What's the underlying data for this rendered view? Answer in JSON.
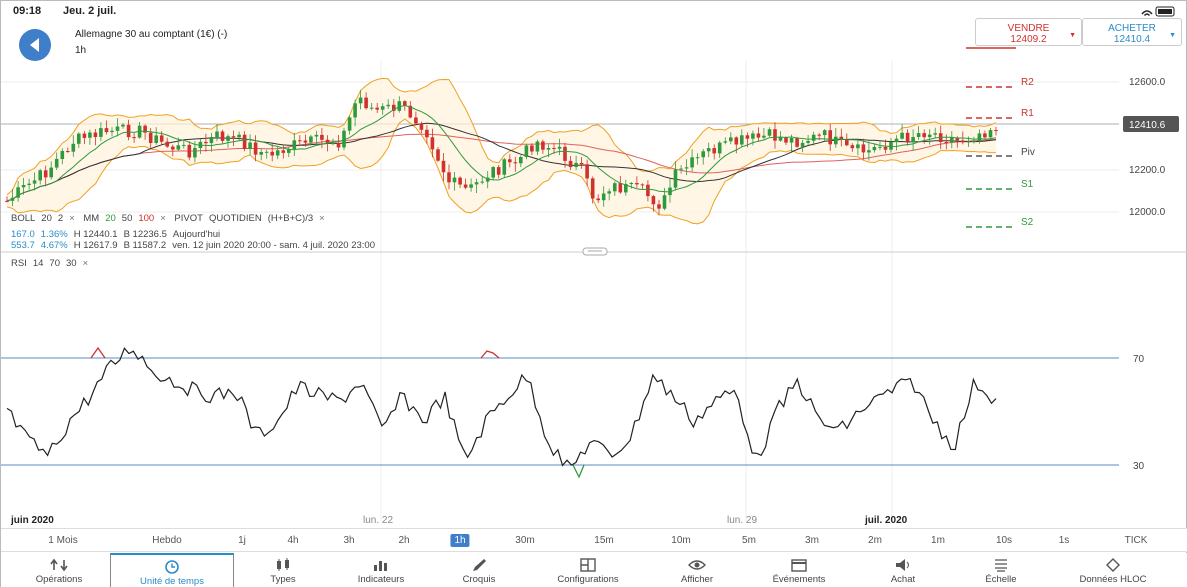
{
  "status": {
    "time": "09:18",
    "date": "Jeu. 2 juil."
  },
  "instrument": {
    "title": "Allemagne 30 au comptant (1€) (-)",
    "timeframe": "1h"
  },
  "trade": {
    "sell": {
      "label": "VENDRE",
      "price": "12409.2"
    },
    "buy": {
      "label": "ACHETER",
      "price": "12410.4"
    }
  },
  "price_axis": {
    "ticks": [
      "12600.0",
      "12200.0",
      "12000.0"
    ],
    "current": "12410.6"
  },
  "pivot_levels": [
    "R2",
    "R1",
    "Piv",
    "S1",
    "S2"
  ],
  "indicators": {
    "boll": {
      "name": "BOLL",
      "p1": "20",
      "p2": "2"
    },
    "mm": {
      "name": "MM",
      "p1": "20",
      "p2": "50",
      "p3": "100"
    },
    "pivot": {
      "name": "PIVOT",
      "mode": "QUOTIDIEN",
      "formula": "(H+B+C)/3"
    },
    "stats": {
      "r1_a": "167.0",
      "r1_b": "1.36%",
      "r1_h": "H 12440.1",
      "r1_l": "B 12236.5",
      "r1_label": "Aujourd'hui",
      "r2_a": "553.7",
      "r2_b": "4.67%",
      "r2_h": "H 12617.9",
      "r2_l": "B 11587.2",
      "r2_label": "ven. 12 juin 2020 20:00 - sam. 4 juil. 2020 23:00"
    },
    "rsi": {
      "name": "RSI",
      "p1": "14",
      "p2": "70",
      "p3": "30",
      "upper": "70",
      "lower": "30"
    }
  },
  "close_glyph": "×",
  "date_axis": [
    "juin 2020",
    "lun. 22",
    "lun. 29",
    "juil. 2020"
  ],
  "timeframes": [
    "1 Mois",
    "Hebdo",
    "1j",
    "4h",
    "3h",
    "2h",
    "1h",
    "30m",
    "15m",
    "10m",
    "5m",
    "3m",
    "2m",
    "1m",
    "10s",
    "1s",
    "TICK"
  ],
  "active_timeframe": "1h",
  "tabs": [
    {
      "label": "Opérations",
      "icon": "arrows-icon"
    },
    {
      "label": "Unité de temps",
      "icon": "clock-icon"
    },
    {
      "label": "Types",
      "icon": "candles-icon"
    },
    {
      "label": "Indicateurs",
      "icon": "bars-icon"
    },
    {
      "label": "Croquis",
      "icon": "pencil-icon"
    },
    {
      "label": "Configurations",
      "icon": "layout-icon"
    },
    {
      "label": "Afficher",
      "icon": "eye-icon"
    },
    {
      "label": "Événements",
      "icon": "calendar-icon"
    },
    {
      "label": "Achat",
      "icon": "speaker-icon"
    },
    {
      "label": "Échelle",
      "icon": "scale-icon"
    },
    {
      "label": "Données HLOC",
      "icon": "diamond-icon"
    }
  ],
  "active_tab": "Unité de temps",
  "colors": {
    "accent": "#3f7ec8",
    "sell": "#d0312d",
    "buy": "#2a8cc9",
    "up": "#2e9a3c",
    "down": "#d0312d",
    "boll": "#f0a020"
  }
}
